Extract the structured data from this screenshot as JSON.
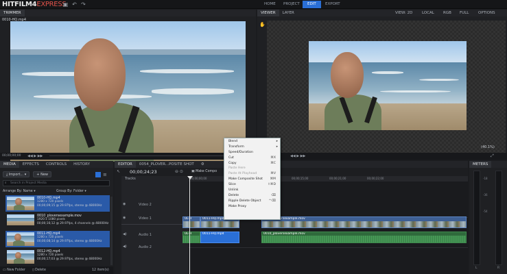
{
  "app": {
    "logo_main": "HITFILM4",
    "logo_sub": "EXPRESS"
  },
  "top_tabs": [
    {
      "label": "HOME"
    },
    {
      "label": "PROJECT"
    },
    {
      "label": "EDIT"
    },
    {
      "label": "EXPORT"
    }
  ],
  "active_top_tab": "EDIT",
  "trimmer": {
    "header": "TRIMMER",
    "filename": "0010-HQ.mp4",
    "timecode": "00;00;00;00"
  },
  "viewer": {
    "tabs": [
      "VIEWER",
      "LAYER"
    ],
    "options": [
      "VIEW: 2D",
      "LOCAL",
      "RGB",
      "FULL",
      "OPTIONS"
    ],
    "zoom": "(40.1%)"
  },
  "left_panel": {
    "tabs": [
      "MEDIA",
      "EFFECTS",
      "CONTROLS",
      "HISTORY"
    ],
    "import_label": "Import...",
    "new_label": "New",
    "search_placeholder": "Search in Project Media",
    "arrange_label": "Arrange By: Name",
    "group_label": "Group By: Folder",
    "items": [
      {
        "name": "0010-HQ.mp4",
        "l1": "1280 x 720 pixels",
        "l2": "00;00;09;15 @ 29.97fps, stereo @ 48000Hz"
      },
      {
        "name": "0010_ploversexample.mov",
        "l1": "1920 x 1080 pixels",
        "l2": "00;00;16;12 @ 29.97fps, 4 channels @ 48000Hz"
      },
      {
        "name": "0011-HQ.mp4",
        "l1": "1280 x 720 pixels",
        "l2": "00;00;08;14 @ 29.97fps, stereo @ 48000Hz"
      },
      {
        "name": "0012-HQ.mp4",
        "l1": "1280 x 720 pixels",
        "l2": "00;00;17;03 @ 29.97fps, stereo @ 48000Hz"
      }
    ],
    "footer_new_folder": "New Folder",
    "footer_delete": "Delete",
    "footer_count": "12 item(s)"
  },
  "editor": {
    "tabs": [
      "EDITOR",
      "0054_PLOVER...POSITE SHOT"
    ],
    "timecode": "00;00;24;23",
    "make_composite": "Make Compo",
    "tracks_label": "Tracks",
    "track_names": [
      "Video 2",
      "Video 1",
      "Audio 1",
      "Audio 2"
    ],
    "ruler_labels": [
      "00;00;00;00",
      "00;00;10;00",
      "00;00;15;00",
      "00;00;21;00",
      "00;00;22;00"
    ],
    "clips": {
      "v1": [
        "0L-H",
        "0011-HQ.mp4",
        "0010_ploversexample.mov"
      ],
      "a1": [
        "0L-H",
        "0011-HQ.mp4",
        "0010_ploversexample.mov"
      ]
    }
  },
  "context_menu": [
    {
      "label": "Blend",
      "sub": true
    },
    {
      "label": "Transform",
      "sub": true
    },
    {
      "label": "Speed/Duration"
    },
    {
      "label": "Cut",
      "shortcut": "⌘X"
    },
    {
      "label": "Copy",
      "shortcut": "⌘C"
    },
    {
      "label": "Paste Here",
      "disabled": true
    },
    {
      "label": "Paste At Playhead",
      "shortcut": "⌘V",
      "disabled": true
    },
    {
      "label": "Make Composite Shot",
      "shortcut": "⌘M"
    },
    {
      "label": "Slice",
      "shortcut": "⇧⌘D"
    },
    {
      "label": "Unlink"
    },
    {
      "label": "Delete",
      "shortcut": "⌫"
    },
    {
      "label": "Ripple Delete Object",
      "shortcut": "^⌫"
    },
    {
      "label": "Make Proxy"
    }
  ],
  "meters": {
    "header": "METERS",
    "scale": [
      "-18",
      "-36",
      "-54"
    ],
    "bottom": [
      "L",
      "R"
    ]
  },
  "colors": {
    "accent": "#2a6fd6",
    "video_clip": "#3e5f93",
    "audio_clip": "#2f6a3c",
    "playhead": "#e8e8e8"
  }
}
